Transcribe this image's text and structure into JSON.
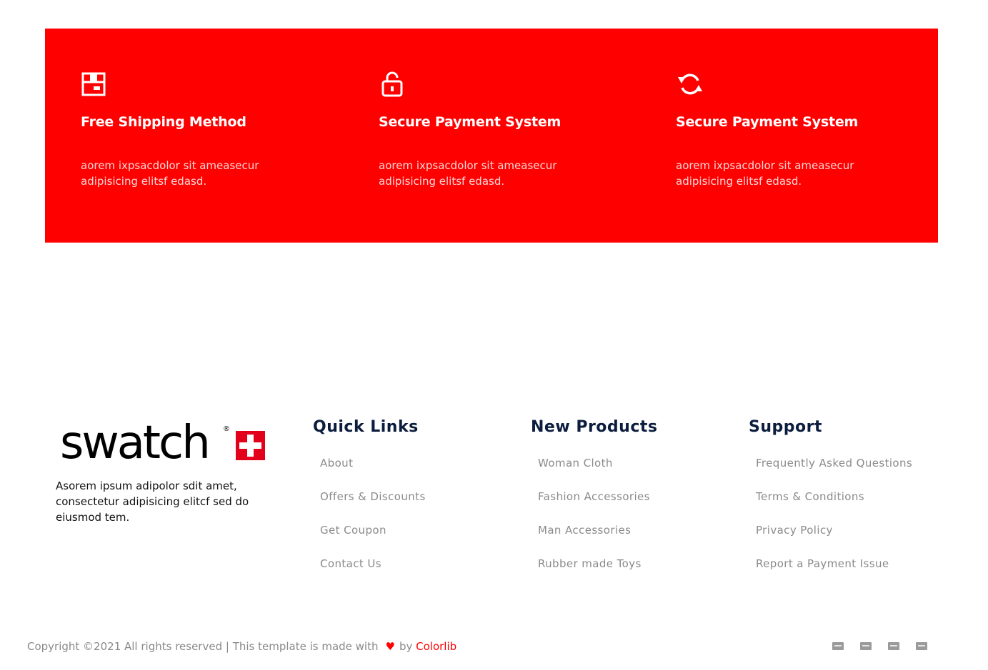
{
  "features": [
    {
      "icon": "box-icon",
      "title": "Free Shipping Method",
      "desc": "aorem ixpsacdolor sit ameasecur adipisicing elitsf edasd."
    },
    {
      "icon": "unlock-icon",
      "title": "Secure Payment System",
      "desc": "aorem ixpsacdolor sit ameasecur adipisicing elitsf edasd."
    },
    {
      "icon": "refresh-icon",
      "title": "Secure Payment System",
      "desc": "aorem ixpsacdolor sit ameasecur adipisicing elitsf edasd."
    }
  ],
  "footer": {
    "logo_text": "swatch",
    "about": "Asorem ipsum adipolor sdit amet, consectetur adipisicing elitcf sed do eiusmod tem.",
    "quick_links": {
      "title": "Quick Links",
      "items": [
        "About",
        "Offers & Discounts",
        "Get Coupon",
        "Contact Us"
      ]
    },
    "new_products": {
      "title": "New Products",
      "items": [
        "Woman Cloth",
        "Fashion Accessories",
        "Man Accessories",
        "Rubber made Toys"
      ]
    },
    "support": {
      "title": "Support",
      "items": [
        "Frequently Asked Questions",
        "Terms & Conditions",
        "Privacy Policy",
        "Report a Payment Issue"
      ]
    }
  },
  "bottom": {
    "copyright_prefix": "Copyright ©2021 All rights reserved | This template is made with",
    "heart": "♥",
    "by": "by",
    "colorlib": "Colorlib",
    "payment_icons": [
      "card-icon",
      "paypal-icon",
      "visa-icon",
      "stripe-icon"
    ]
  },
  "colors": {
    "accent": "#ff0000",
    "heading": "#0b1c3d",
    "muted": "#8a8a8a"
  }
}
